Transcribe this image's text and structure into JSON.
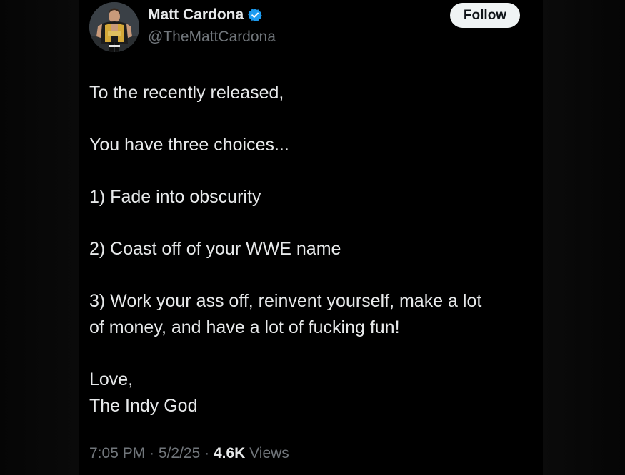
{
  "author": {
    "display_name": "Matt Cardona",
    "handle": "@TheMattCardona",
    "verified_icon": "verified-badge-icon",
    "avatar": "profile-avatar"
  },
  "follow_button": {
    "label": "Follow"
  },
  "tweet": {
    "lines": [
      "To the recently released,",
      "You have three choices...",
      "1) Fade into obscurity",
      "2) Coast off of your WWE name",
      "3) Work your ass off, reinvent yourself, make a lot",
      "of money, and have a lot of fucking fun!",
      "Love,",
      "The Indy God"
    ]
  },
  "meta": {
    "time": "7:05 PM",
    "separator": " · ",
    "date": "5/2/25",
    "views_count": "4.6K",
    "views_label": "Views"
  },
  "colors": {
    "background": "#000000",
    "text_primary": "#e7e9ea",
    "text_secondary": "#71767b",
    "verified_blue": "#1d9bf0",
    "button_bg": "#eff3f4"
  }
}
